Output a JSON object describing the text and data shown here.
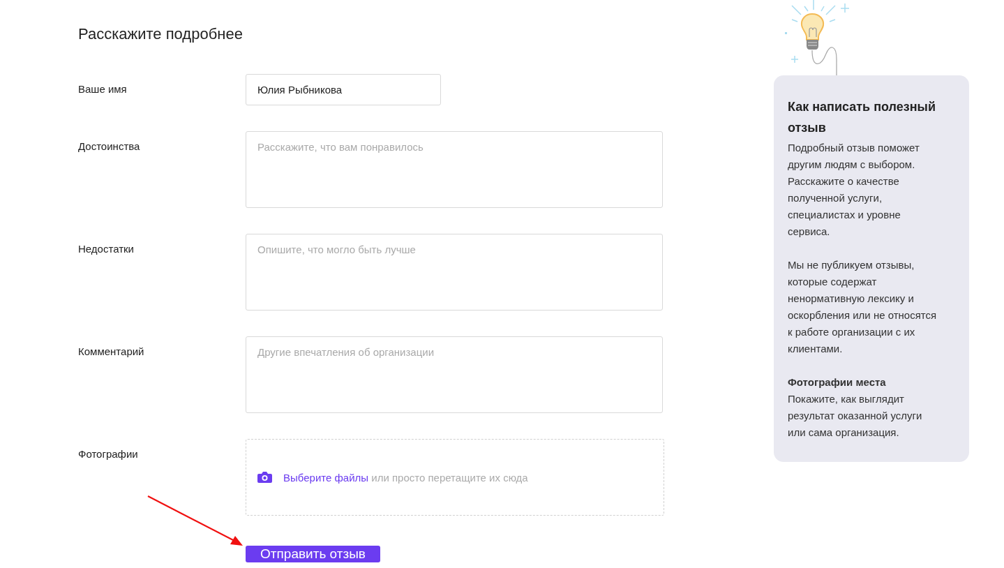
{
  "title": "Расскажите подробнее",
  "fields": [
    {
      "kind": "input",
      "label": "Ваше имя",
      "value": "Юлия Рыбникова"
    },
    {
      "kind": "textarea",
      "label": "Достоинства",
      "placeholder": "Расскажите, что вам понравилось"
    },
    {
      "kind": "textarea",
      "label": "Недостатки",
      "placeholder": "Опишите, что могло быть лучше"
    },
    {
      "kind": "textarea",
      "label": "Комментарий",
      "placeholder": "Другие впечатления об организации"
    },
    {
      "kind": "upload",
      "label": "Фотографии",
      "link": "Выберите файлы",
      "hint": "или просто перетащите их сюда"
    }
  ],
  "submit": "Отправить отзыв",
  "tips": {
    "title": "Как написать полезный отзыв",
    "paragraphs": [
      {
        "kind": "text",
        "text": "Подробный отзыв поможет другим людям с выбором. Расскажите о качестве полученной услуги, специалистах и уровне сервиса."
      },
      {
        "kind": "text",
        "text": "Мы не публикуем отзывы, которые содержат ненормативную лексику и оскорбления или не относятся к работе организации с их клиентами."
      },
      {
        "kind": "heading",
        "text": "Фотографии места"
      },
      {
        "kind": "text",
        "text": "Покажите, как выглядит результат оказанной услуги или сама организация."
      }
    ]
  }
}
